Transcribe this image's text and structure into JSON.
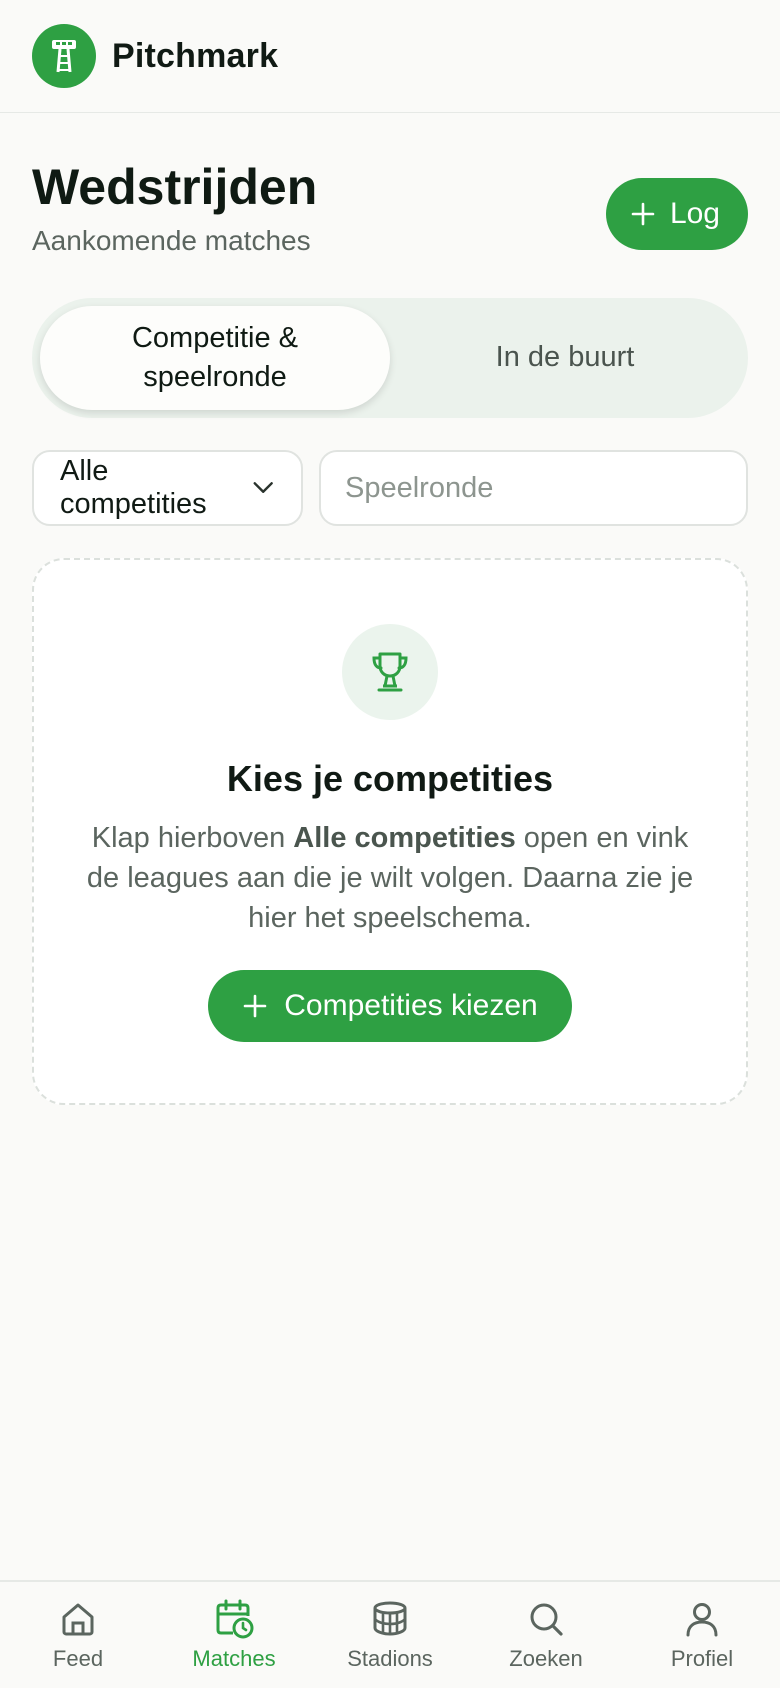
{
  "header": {
    "brand": "Pitchmark",
    "logo_icon": "stadium-light-icon"
  },
  "page": {
    "title": "Wedstrijden",
    "subtitle": "Aankomende matches",
    "log_button": "Log"
  },
  "tabs": [
    {
      "label": "Competitie & speelronde",
      "active": true
    },
    {
      "label": "In de buurt",
      "active": false
    }
  ],
  "filters": {
    "competition_select": "Alle competities",
    "round_placeholder": "Speelronde"
  },
  "empty_state": {
    "icon": "trophy-icon",
    "title": "Kies je competities",
    "text_before": "Klap hierboven ",
    "text_bold": "Alle competities",
    "text_after": " open en vink de leagues aan die je wilt volgen. Daarna zie je hier het speelschema.",
    "button": "Competities kiezen"
  },
  "nav": [
    {
      "label": "Feed",
      "icon": "home-icon",
      "active": false
    },
    {
      "label": "Matches",
      "icon": "calendar-clock-icon",
      "active": true
    },
    {
      "label": "Stadions",
      "icon": "stadium-icon",
      "active": false
    },
    {
      "label": "Zoeken",
      "icon": "search-icon",
      "active": false
    },
    {
      "label": "Profiel",
      "icon": "user-icon",
      "active": false
    }
  ],
  "colors": {
    "accent": "#2ea043",
    "accent_soft": "#ebf2ec",
    "text": "#101a14",
    "muted": "#5b655f"
  }
}
